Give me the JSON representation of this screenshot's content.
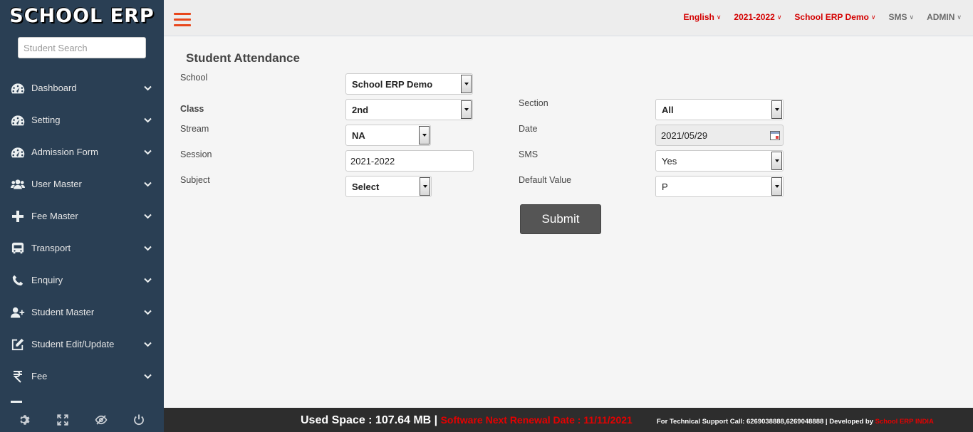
{
  "app": {
    "logo_text": "SCHOOL ERP"
  },
  "search": {
    "placeholder": "Student Search"
  },
  "sidebar": {
    "items": [
      {
        "label": "Dashboard",
        "icon": "dashboard-icon"
      },
      {
        "label": "Setting",
        "icon": "dashboard-icon"
      },
      {
        "label": "Admission Form",
        "icon": "dashboard-icon"
      },
      {
        "label": "User Master",
        "icon": "users-icon"
      },
      {
        "label": "Fee Master",
        "icon": "plus-icon"
      },
      {
        "label": "Transport",
        "icon": "bus-icon"
      },
      {
        "label": "Enquiry",
        "icon": "phone-icon"
      },
      {
        "label": "Student Master",
        "icon": "user-plus-icon"
      },
      {
        "label": "Student Edit/Update",
        "icon": "edit-icon"
      },
      {
        "label": "Fee",
        "icon": "rupee-icon"
      }
    ],
    "footer_icons": [
      "settings-icon",
      "fullscreen-icon",
      "eye-slash-icon",
      "power-icon"
    ]
  },
  "topnav": {
    "language": "English",
    "session": "2021-2022",
    "school": "School ERP Demo",
    "sms": "SMS",
    "user": "ADMIN",
    "colors": {
      "red": "#d40000",
      "gray": "#6b6b6b"
    }
  },
  "form": {
    "title": "Student Attendance",
    "school": {
      "label": "School",
      "value": "School ERP Demo"
    },
    "class": {
      "label": "Class",
      "value": "2nd"
    },
    "section": {
      "label": "Section",
      "value": "All"
    },
    "stream": {
      "label": "Stream",
      "value": "NA"
    },
    "date": {
      "label": "Date",
      "value": "2021/05/29"
    },
    "session": {
      "label": "Session",
      "value": "2021-2022"
    },
    "sms": {
      "label": "SMS",
      "value": "Yes"
    },
    "subject": {
      "label": "Subject",
      "value": "Select"
    },
    "default_value": {
      "label": "Default Value",
      "value": "P"
    },
    "submit_label": "Submit"
  },
  "footer": {
    "used_space": "Used Space : 107.64 MB |",
    "renewal": "Software Next Renewal Date : 11/11/2021",
    "support": "For Technical  Support Call: 6269038888,6269048888 | Developed by ",
    "developer": "School ERP INDIA"
  }
}
